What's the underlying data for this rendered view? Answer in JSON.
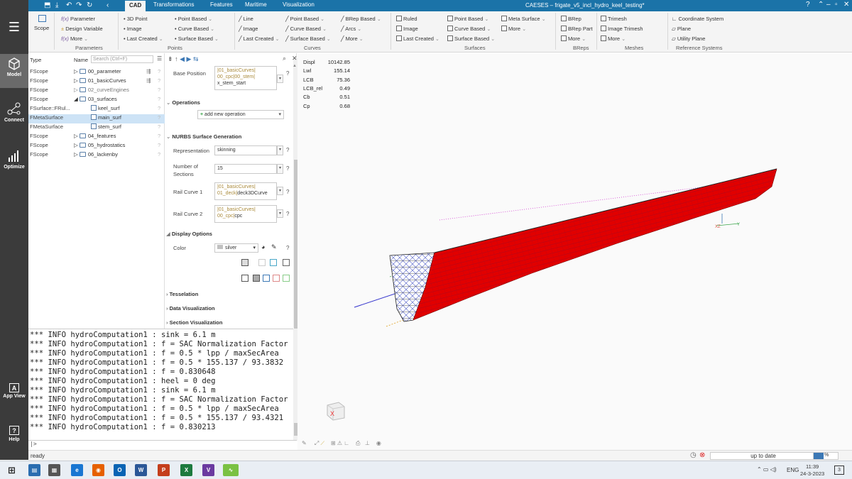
{
  "window": {
    "title": "CAESES – frigate_v5_incl_hydro_keel_testing*"
  },
  "menu_tabs": [
    "CAD",
    "Transformations",
    "Features",
    "Maritime",
    "Visualization"
  ],
  "left_nav": [
    {
      "label": "Model",
      "icon": "cube-icon"
    },
    {
      "label": "Connect",
      "icon": "connect-icon"
    },
    {
      "label": "Optimize",
      "icon": "bar-chart-icon"
    },
    {
      "label": "App View",
      "icon": "app-view-icon"
    },
    {
      "label": "Help",
      "icon": "help-icon"
    }
  ],
  "ribbon": {
    "scope": "Scope",
    "parameters": {
      "items": [
        "Parameter",
        "Design Variable",
        "More"
      ],
      "group": "Parameters"
    },
    "points": {
      "items": [
        "3D Point",
        "Image",
        "Last Created",
        "Point Based",
        "Curve Based",
        "Surface Based"
      ],
      "group": "Points"
    },
    "curves": {
      "items": [
        "Line",
        "Image",
        "Last Created",
        "Point Based",
        "Curve Based",
        "Surface Based",
        "BRep Based",
        "Arcs",
        "More"
      ],
      "group": "Curves"
    },
    "surfaces": {
      "items": [
        "Ruled",
        "Image",
        "Last Created",
        "Point Based",
        "Curve Based",
        "Surface Based",
        "Meta Surface",
        "More"
      ],
      "group": "Surfaces"
    },
    "breps": {
      "items": [
        "BRep",
        "BRep Part",
        "More"
      ],
      "group": "BReps"
    },
    "meshes": {
      "items": [
        "Trimesh",
        "Image Trimesh",
        "More"
      ],
      "group": "Meshes"
    },
    "refsys": {
      "items": [
        "Coordinate System",
        "Plane",
        "Utility Plane"
      ],
      "group": "Reference Systems"
    }
  },
  "tree": {
    "col_type": "Type",
    "col_name": "Name",
    "search_placeholder": "Search (Ctrl+F)",
    "rows": [
      {
        "type": "FScope",
        "name": "00_parameter"
      },
      {
        "type": "FScope",
        "name": "01_basicCurves"
      },
      {
        "type": "FScope",
        "name": "02_curveEngines"
      },
      {
        "type": "FScope",
        "name": "03_surfaces"
      },
      {
        "type": "FSurface::FRul...",
        "name": "keel_surf"
      },
      {
        "type": "FMetaSurface",
        "name": "main_surf"
      },
      {
        "type": "FMetaSurface",
        "name": "stem_surf"
      },
      {
        "type": "FScope",
        "name": "04_features"
      },
      {
        "type": "FScope",
        "name": "05_hydrostatics"
      },
      {
        "type": "FScope",
        "name": "06_lackenby"
      }
    ]
  },
  "props": {
    "base_position_label": "Base Position",
    "base_position_value": [
      "|01_basicCurves|",
      "00_cpc|00_stem|",
      "x_stem_start"
    ],
    "operations_header": "Operations",
    "add_operation": "add new operation",
    "nurbs_header": "NURBS Surface Generation",
    "representation_label": "Representation",
    "representation_value": "skinning",
    "sections_label": "Number of Sections",
    "sections_value": "15",
    "rail1_label": "Rail Curve 1",
    "rail1_value": [
      "|01_basicCurves|",
      "01_deck|deck3DCurve"
    ],
    "rail2_label": "Rail Curve 2",
    "rail2_value": [
      "|01_basicCurves|",
      "00_cpc|cpc"
    ],
    "display_header": "Display Options",
    "color_label": "Color",
    "color_value": "silver",
    "tesselation": "Tesselation",
    "data_vis": "Data Visualization",
    "section_vis": "Section Visualization"
  },
  "console": {
    "lines": [
      "*** INFO hydroComputation1 : sink = 6.1 m",
      "*** INFO hydroComputation1 : f = SAC Normalization Factor",
      "*** INFO hydroComputation1 : f = 0.5 * lpp / maxSecArea",
      "*** INFO hydroComputation1 : f = 0.5 * 155.137 / 93.3832",
      "*** INFO hydroComputation1 : f = 0.830648",
      "*** INFO hydroComputation1 : heel = 0 deg",
      "*** INFO hydroComputation1 : sink = 6.1 m",
      "*** INFO hydroComputation1 : f = SAC Normalization Factor",
      "*** INFO hydroComputation1 : f = 0.5 * lpp / maxSecArea",
      "*** INFO hydroComputation1 : f = 0.5 * 155.137 / 93.4321",
      "*** INFO hydroComputation1 : f = 0.830213"
    ],
    "prompt": "|>"
  },
  "results": [
    {
      "name": "Displ",
      "value": "10142.85"
    },
    {
      "name": "Lwl",
      "value": "155.14"
    },
    {
      "name": "LCB",
      "value": "75.36"
    },
    {
      "name": "LCB_rel",
      "value": "0.49"
    },
    {
      "name": "Cb",
      "value": "0.51"
    },
    {
      "name": "Cp",
      "value": "0.68"
    }
  ],
  "status": {
    "left": "ready",
    "center": "up to date",
    "progress_label": "%"
  },
  "taskbar": {
    "lang": "ENG",
    "time": "11:39",
    "date": "24-3-2023",
    "notif_count": "3"
  },
  "colors": {
    "hull": "#e10000",
    "accent": "#1b73a8",
    "nav": "#3b3b3b"
  }
}
